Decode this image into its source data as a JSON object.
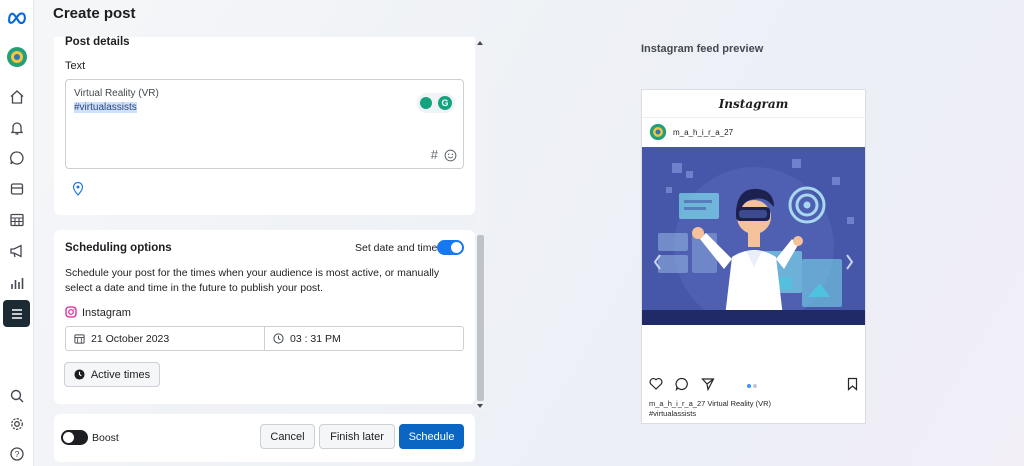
{
  "app": {
    "logo": "meta-logo"
  },
  "page": {
    "title": "Create post"
  },
  "sidebar": {
    "icons": [
      "account-icon",
      "home-icon",
      "notifications-icon",
      "messages-icon",
      "content-icon",
      "planner-icon",
      "ads-icon",
      "insights-icon",
      "menu-icon",
      "search-icon",
      "settings-icon",
      "help-icon"
    ]
  },
  "post_details": {
    "section_title": "Post details",
    "text_label": "Text",
    "text_line1": "Virtual Reality (VR)",
    "text_line2": "#virtualassists",
    "hashtag_symbol": "#",
    "tool_letter": "G"
  },
  "scheduling": {
    "section_title": "Scheduling options",
    "set_date_label": "Set date and time",
    "set_date_enabled": true,
    "description": "Schedule your post for the times when your audience is most active, or manually select a date and time in the future to publish your post.",
    "platform": "Instagram",
    "date": "21 October 2023",
    "time": "03 : 31 PM",
    "active_times_label": "Active times"
  },
  "footer": {
    "boost_label": "Boost",
    "boost_enabled": false,
    "cancel_label": "Cancel",
    "finish_later_label": "Finish later",
    "schedule_label": "Schedule"
  },
  "preview": {
    "title": "Instagram feed preview",
    "brand": "Instagram",
    "username": "m_a_h_i_r_a_27",
    "caption_line1": "m_a_h_i_r_a_27 Virtual Reality (VR)",
    "caption_line2": "#virtualassists"
  },
  "colors": {
    "primary": "#0a66c2",
    "toggle_on": "#1877f2",
    "illustration_bg": "#4656a8",
    "highlight": "#cfe0fa"
  }
}
